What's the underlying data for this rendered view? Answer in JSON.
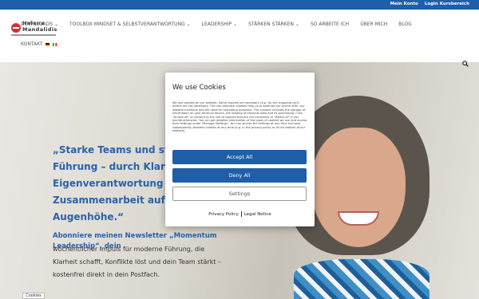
{
  "topbar": {
    "account": "Mein Konto",
    "login": "Login Kursbereich"
  },
  "logo": {
    "line1": "Helena",
    "line2": "Mandalidis"
  },
  "nav": {
    "items": [
      "DOWNLOADS ⌄",
      "TOOLBOX MINDSET & SELBSTVERANTWORTUNG ⌄",
      "LEADERSHIP ⌄",
      "STÄRKEN STÄRKEN ⌄",
      "SO ARBEITE ICH",
      "ÜBER MICH",
      "BLOG"
    ],
    "kontakt": "KONTAKT"
  },
  "hero": {
    "quote": "„Starke Teams und starke Führung – durch Klarheit, Eigenverantwortung und echte Zusammenarbeit auf Augenhöhe.“",
    "newsletter_title": "Abonniere meinen Newsletter „Momentum Leadership“, dein",
    "newsletter_body": "wöchentlicher Impuls für moderne Führung, die Klarheit schafft, Konflikte löst und dein Team stärkt – kostenfrei direkt in dein Postfach."
  },
  "cookie_tab": "Cookies",
  "cookie_modal": {
    "title": "We use Cookies",
    "text": "We use cookies on our website. Some cookies are necessary (e.g. for the shopping cart) others are not necessary. The non-essential cookies help us to optimize our online offer, our website functions and are used for marketing purposes. The consent includes the storage of information on your terminal device, the reading of personal data and its processing. Click \"Accept all\" to consent to the use of cookies that are not necessary or \"Reject all\" if you decide otherwise. You can get detailed information of the types of cookies we use and access their settings under \"Manage Settings\". You can access the settings at any time and also subsequently deselect cookies at any time (e.g. in the privacy policy or at the bottom of our website).",
    "accept": "Accept All",
    "deny": "Deny All",
    "settings": "Settings",
    "privacy": "Privacy Policy",
    "legal": "Legal Notice"
  },
  "colors": {
    "brand_blue": "#1f5ea8",
    "logo_red": "#d0343a"
  },
  "icons": {
    "search": "search-icon"
  }
}
